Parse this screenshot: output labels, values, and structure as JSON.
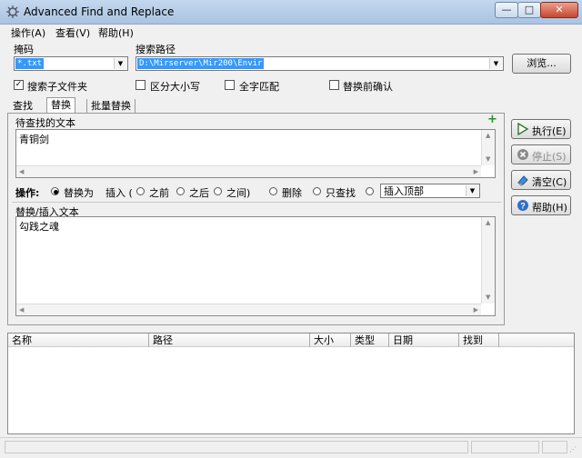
{
  "window": {
    "title": "Advanced Find and Replace"
  },
  "menu": [
    "操作(A)",
    "查看(V)",
    "帮助(H)"
  ],
  "mask": {
    "label": "掩码",
    "value": "*.txt"
  },
  "path": {
    "label": "搜索路径",
    "value": "D:\\Mirserver\\Mir200\\Envir"
  },
  "browse_label": "浏览...",
  "options": {
    "subfolders": "搜索子文件夹",
    "case": "区分大小写",
    "whole": "全字匹配",
    "confirm": "替换前确认"
  },
  "tabs": [
    "查找",
    "替换",
    "批量替换"
  ],
  "find_label": "待查找的文本",
  "find_text": "青铜剑",
  "operation": {
    "label": "操作:",
    "replace_with": "替换为",
    "insert": "插入 (",
    "before": "之前",
    "after": "之后",
    "between": "之间)",
    "delete": "删除",
    "find_only": "只查找",
    "insert_top": "插入顶部"
  },
  "replace_label": "替换/插入文本",
  "replace_text": "勾践之魂",
  "buttons": {
    "execute": "执行(E)",
    "stop": "停止(S)",
    "clear": "清空(C)",
    "help": "帮助(H)"
  },
  "results_columns": [
    "名称",
    "路径",
    "大小",
    "类型",
    "日期",
    "找到"
  ],
  "colors": {
    "accent": "#3399ff",
    "title_bg": "#b7cde8",
    "close_red": "#c7472e"
  }
}
